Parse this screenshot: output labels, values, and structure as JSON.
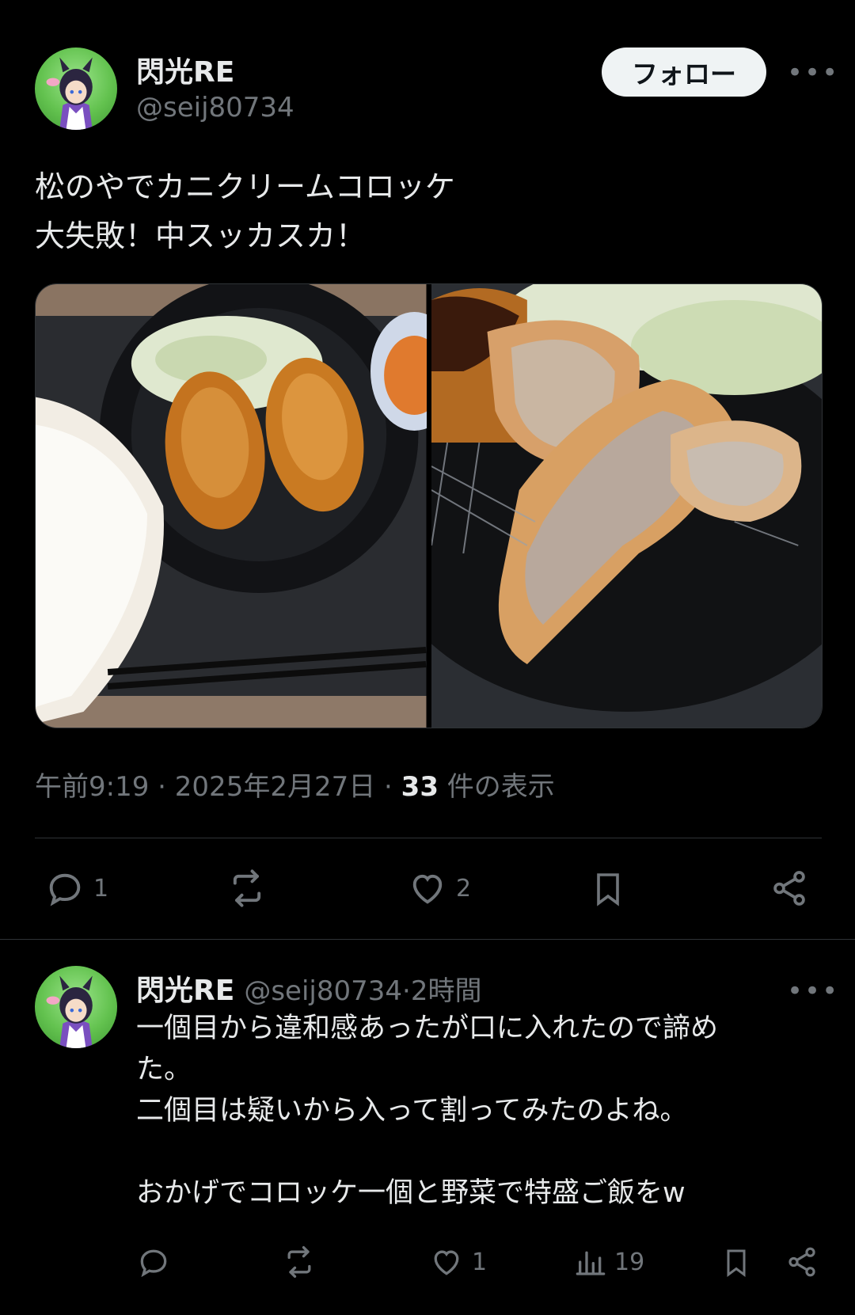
{
  "post": {
    "display_name": "閃光RE",
    "handle": "@seij80734",
    "follow_label": "フォロー",
    "more_label": "•••",
    "text_lines": [
      "松のやでカニクリームコロッケ",
      "大失敗！中スッカスカ！"
    ],
    "time": "午前9:19",
    "sep1": " · ",
    "date": "2025年2月27日",
    "sep2": " · ",
    "views_count": "33",
    "views_label": " 件の表示",
    "replies": "1",
    "likes": "2"
  },
  "reply": {
    "display_name": "閃光RE",
    "handle": "@seij80734",
    "sep": " · ",
    "time_ago": "2時間",
    "more_label": "•••",
    "text_lines": [
      "一個目から違和感あったが口に入れたので諦め",
      "た。",
      "二個目は疑いから入って割ってみたのよね。",
      "",
      "おかげでコロッケ一個と野菜で特盛ご飯をw"
    ],
    "likes": "1",
    "views": "19"
  },
  "icons": [
    "reply-icon",
    "retweet-icon",
    "like-icon",
    "bookmark-icon",
    "share-icon",
    "views-icon"
  ],
  "colors": {
    "background": "#000000",
    "text": "#e7e9ea",
    "secondary": "#71767b",
    "divider": "#2f3336",
    "follow_bg": "#eff3f4"
  }
}
